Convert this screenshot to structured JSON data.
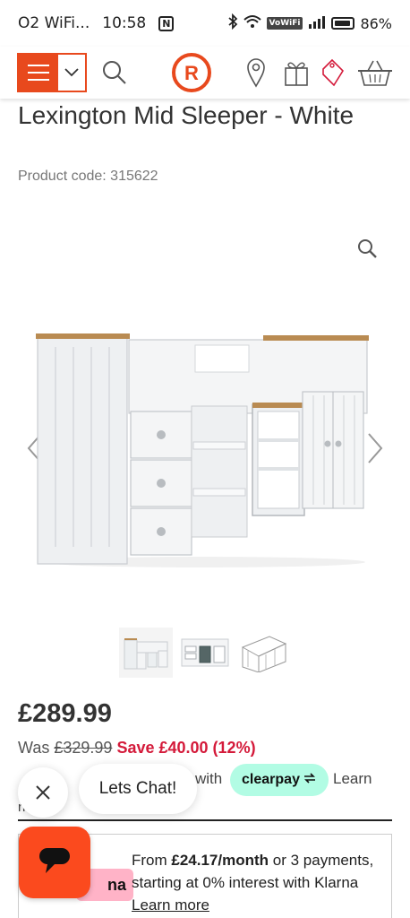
{
  "status": {
    "carrier": "O2 WiFi...",
    "time": "10:58",
    "n_badge": "N",
    "vowifi": "VoWiFi",
    "battery": "86%"
  },
  "header": {
    "icons": [
      "menu-icon",
      "chevron-down-icon",
      "search-icon",
      "logo-r-icon",
      "location-pin-icon",
      "gift-icon",
      "tag-icon",
      "basket-icon"
    ],
    "logo_letter": "R",
    "brand_color": "#e8491d"
  },
  "product": {
    "title": "Lexington Mid Sleeper - White",
    "code": "Product code: 315622",
    "price": "£289.99",
    "was_label": "Was",
    "was_price": "£329.99",
    "save": "Save £40.00 (12%)",
    "thumbnails": 3
  },
  "clearpay": {
    "partial_text": "with",
    "badge": "clearpay",
    "learn": "Learn",
    "second_line": "n"
  },
  "chat": {
    "label": "Lets Chat!"
  },
  "klarna": {
    "badge": "na",
    "text_prefix": "From ",
    "amount": "£24.17/month",
    "text_mid": " or 3 payments, starting at 0% interest with Klarna ",
    "learn_more": "Learn more"
  },
  "colors": {
    "accent": "#e8491d",
    "save_red": "#d41a3a",
    "clearpay_mint": "#b2fce4",
    "klarna_pink": "#ffb3c7",
    "chat_orange": "#fb4a1e"
  }
}
